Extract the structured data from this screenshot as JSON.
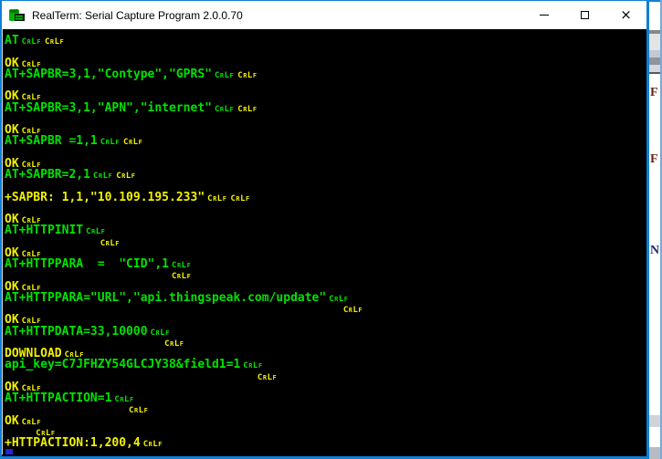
{
  "window": {
    "title": "RealTerm: Serial Capture Program 2.0.0.70",
    "controls": {
      "close_glyph": "×"
    }
  },
  "colors": {
    "terminal_background": "#000000",
    "tx_green": "#00e300",
    "rx_yellow": "#f2f200",
    "titlebar_background": "#ffffff",
    "title_text": "#000000",
    "accent_border": "#0f7fd7",
    "cursor_blue": "#2424d8"
  },
  "terminal": {
    "crlf_marker": "CRLF",
    "rows": [
      [
        {
          "text": "AT",
          "color": "g"
        },
        {
          "marker": "crlf",
          "color": "g"
        },
        {
          "marker": "crlf",
          "color": "y"
        }
      ],
      [],
      [
        {
          "text": "OK",
          "color": "y"
        },
        {
          "marker": "crlf",
          "color": "y"
        }
      ],
      [
        {
          "text": "AT+SAPBR=3,1,\"Contype\",\"GPRS\"",
          "color": "g"
        },
        {
          "marker": "crlf",
          "color": "g"
        },
        {
          "marker": "crlf",
          "color": "y"
        }
      ],
      [],
      [
        {
          "text": "OK",
          "color": "y"
        },
        {
          "marker": "crlf",
          "color": "y"
        }
      ],
      [
        {
          "text": "AT+SAPBR=3,1,\"APN\",\"internet\"",
          "color": "g"
        },
        {
          "marker": "crlf",
          "color": "g"
        },
        {
          "marker": "crlf",
          "color": "y"
        }
      ],
      [],
      [
        {
          "text": "OK",
          "color": "y"
        },
        {
          "marker": "crlf",
          "color": "y"
        }
      ],
      [
        {
          "text": "AT+SAPBR =1,1",
          "color": "g"
        },
        {
          "marker": "crlf",
          "color": "g"
        },
        {
          "marker": "crlf",
          "color": "y"
        }
      ],
      [],
      [
        {
          "text": "OK",
          "color": "y"
        },
        {
          "marker": "crlf",
          "color": "y"
        }
      ],
      [
        {
          "text": "AT+SAPBR=2,1",
          "color": "g"
        },
        {
          "marker": "crlf",
          "color": "g"
        },
        {
          "marker": "crlf",
          "color": "y"
        }
      ],
      [],
      [
        {
          "text": "+SAPBR: 1,1,\"10.109.195.233\"",
          "color": "y"
        },
        {
          "marker": "crlf",
          "color": "y"
        },
        {
          "marker": "crlf",
          "color": "y"
        }
      ],
      [],
      [
        {
          "text": "OK",
          "color": "y"
        },
        {
          "marker": "crlf",
          "color": "y"
        }
      ],
      [
        {
          "text": "AT+HTTPINIT",
          "color": "g"
        },
        {
          "marker": "crlf",
          "color": "g"
        }
      ],
      [
        {
          "pad": 13
        },
        {
          "marker": "crlf",
          "color": "y"
        }
      ],
      [
        {
          "text": "OK",
          "color": "y"
        },
        {
          "marker": "crlf",
          "color": "y"
        }
      ],
      [
        {
          "text": "AT+HTTPPARA  =  \"CID\",1",
          "color": "g"
        },
        {
          "marker": "crlf",
          "color": "g"
        }
      ],
      [
        {
          "pad": 23
        },
        {
          "marker": "crlf",
          "color": "y"
        }
      ],
      [
        {
          "text": "OK",
          "color": "y"
        },
        {
          "marker": "crlf",
          "color": "y"
        }
      ],
      [
        {
          "text": "AT+HTTPPARA=\"URL\",\"api.thingspeak.com/update\"",
          "color": "g"
        },
        {
          "marker": "crlf",
          "color": "g"
        }
      ],
      [
        {
          "pad": 47
        },
        {
          "marker": "crlf",
          "color": "y"
        }
      ],
      [
        {
          "text": "OK",
          "color": "y"
        },
        {
          "marker": "crlf",
          "color": "y"
        }
      ],
      [
        {
          "text": "AT+HTTPDATA=33,10000",
          "color": "g"
        },
        {
          "marker": "crlf",
          "color": "g"
        }
      ],
      [
        {
          "pad": 22
        },
        {
          "marker": "crlf",
          "color": "y"
        }
      ],
      [
        {
          "text": "DOWNLOAD",
          "color": "y"
        },
        {
          "marker": "crlf",
          "color": "y"
        }
      ],
      [
        {
          "text": "api_key=C7JFHZY54GLCJY38&field1=1",
          "color": "g"
        },
        {
          "marker": "crlf",
          "color": "g"
        }
      ],
      [
        {
          "pad": 35
        },
        {
          "marker": "crlf",
          "color": "y"
        }
      ],
      [
        {
          "text": "OK",
          "color": "y"
        },
        {
          "marker": "crlf",
          "color": "y"
        }
      ],
      [
        {
          "text": "AT+HTTPACTION=1",
          "color": "g"
        },
        {
          "marker": "crlf",
          "color": "g"
        }
      ],
      [
        {
          "pad": 17
        },
        {
          "marker": "crlf",
          "color": "y"
        }
      ],
      [
        {
          "text": "OK",
          "color": "y"
        },
        {
          "marker": "crlf",
          "color": "y"
        }
      ],
      [
        {
          "pad": 4
        },
        {
          "marker": "crlf",
          "color": "y"
        }
      ],
      [
        {
          "text": "+HTTPACTION:1,200,4",
          "color": "y"
        },
        {
          "marker": "crlf",
          "color": "y"
        }
      ],
      [
        {
          "cursor": true
        }
      ]
    ]
  }
}
